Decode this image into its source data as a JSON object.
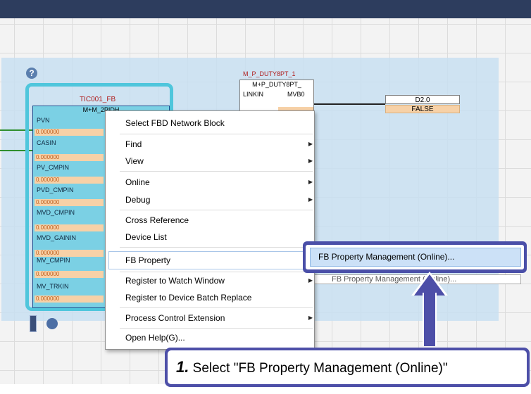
{
  "fbd": {
    "fb1_instance": "TIC001_FB",
    "fb1_type": "M+M_2PIDH",
    "pins": [
      {
        "name": "PVN",
        "value": "0.000000"
      },
      {
        "name": "CASIN",
        "value": "0.000000"
      },
      {
        "name": "PV_CMPIN",
        "value": "0.000000"
      },
      {
        "name": "PVD_CMPIN",
        "value": "0.000000"
      },
      {
        "name": "MVD_CMPIN",
        "value": "0.000000"
      },
      {
        "name": "MVD_GAININ",
        "value": "0.000000"
      },
      {
        "name": "MV_CMPIN",
        "value": "0.000000"
      },
      {
        "name": "MV_TRKIN",
        "value": "0.000000"
      }
    ],
    "fb2_instance": "M_P_DUTY8PT_1",
    "fb2_type": "M+P_DUTY8PT_",
    "fb2_in": "LINKIN",
    "fb2_out": "MVB0",
    "out_label": "D2.0",
    "out_value": "FALSE"
  },
  "menu": {
    "items": [
      {
        "label": "Select FBD Network Block"
      },
      {
        "label": "Find"
      },
      {
        "label": "View"
      },
      {
        "label": "Online"
      },
      {
        "label": "Debug"
      },
      {
        "label": "Cross Reference"
      },
      {
        "label": "Device List"
      },
      {
        "label": "FB Property"
      },
      {
        "label": "Register to Watch Window"
      },
      {
        "label": "Register to Device Batch Replace"
      },
      {
        "label": "Process Control Extension"
      },
      {
        "label": "Open Help(G)..."
      }
    ],
    "submenu_label": "FB Property Management (Online)..."
  },
  "callout": {
    "number": "1.",
    "text": "Select \"FB Property Management (Online)\""
  },
  "colors": {
    "accent": "#4d4fa8",
    "fb_block": "#7bd0e4",
    "fb_frame": "#4fc6dc",
    "network_bg": "#c8dff1"
  }
}
